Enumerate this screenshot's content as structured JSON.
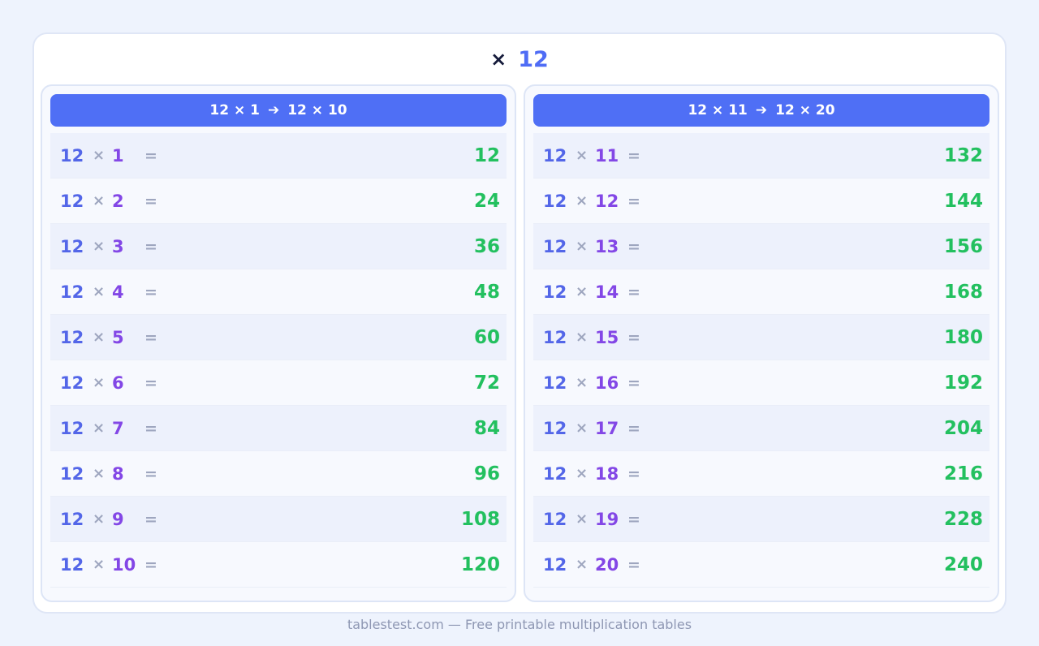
{
  "title": {
    "times_symbol": "×",
    "number": "12"
  },
  "colors": {
    "accent": "#4f6ff5",
    "multiplicand": "#5366e8",
    "multiplier": "#8347e6",
    "operator": "#9ea6bf",
    "result": "#23c05f"
  },
  "panels": [
    {
      "header": {
        "start": "12 × 1",
        "arrow": "➔",
        "end": "12 × 10"
      },
      "rows": [
        {
          "a": "12",
          "x": "×",
          "b": "1",
          "eq": "=",
          "result": "12"
        },
        {
          "a": "12",
          "x": "×",
          "b": "2",
          "eq": "=",
          "result": "24"
        },
        {
          "a": "12",
          "x": "×",
          "b": "3",
          "eq": "=",
          "result": "36"
        },
        {
          "a": "12",
          "x": "×",
          "b": "4",
          "eq": "=",
          "result": "48"
        },
        {
          "a": "12",
          "x": "×",
          "b": "5",
          "eq": "=",
          "result": "60"
        },
        {
          "a": "12",
          "x": "×",
          "b": "6",
          "eq": "=",
          "result": "72"
        },
        {
          "a": "12",
          "x": "×",
          "b": "7",
          "eq": "=",
          "result": "84"
        },
        {
          "a": "12",
          "x": "×",
          "b": "8",
          "eq": "=",
          "result": "96"
        },
        {
          "a": "12",
          "x": "×",
          "b": "9",
          "eq": "=",
          "result": "108"
        },
        {
          "a": "12",
          "x": "×",
          "b": "10",
          "eq": "=",
          "result": "120"
        }
      ]
    },
    {
      "header": {
        "start": "12 × 11",
        "arrow": "➔",
        "end": "12 × 20"
      },
      "rows": [
        {
          "a": "12",
          "x": "×",
          "b": "11",
          "eq": "=",
          "result": "132"
        },
        {
          "a": "12",
          "x": "×",
          "b": "12",
          "eq": "=",
          "result": "144"
        },
        {
          "a": "12",
          "x": "×",
          "b": "13",
          "eq": "=",
          "result": "156"
        },
        {
          "a": "12",
          "x": "×",
          "b": "14",
          "eq": "=",
          "result": "168"
        },
        {
          "a": "12",
          "x": "×",
          "b": "15",
          "eq": "=",
          "result": "180"
        },
        {
          "a": "12",
          "x": "×",
          "b": "16",
          "eq": "=",
          "result": "192"
        },
        {
          "a": "12",
          "x": "×",
          "b": "17",
          "eq": "=",
          "result": "204"
        },
        {
          "a": "12",
          "x": "×",
          "b": "18",
          "eq": "=",
          "result": "216"
        },
        {
          "a": "12",
          "x": "×",
          "b": "19",
          "eq": "=",
          "result": "228"
        },
        {
          "a": "12",
          "x": "×",
          "b": "20",
          "eq": "=",
          "result": "240"
        }
      ]
    }
  ],
  "footer": {
    "text": "tablestest.com — Free printable multiplication tables"
  }
}
